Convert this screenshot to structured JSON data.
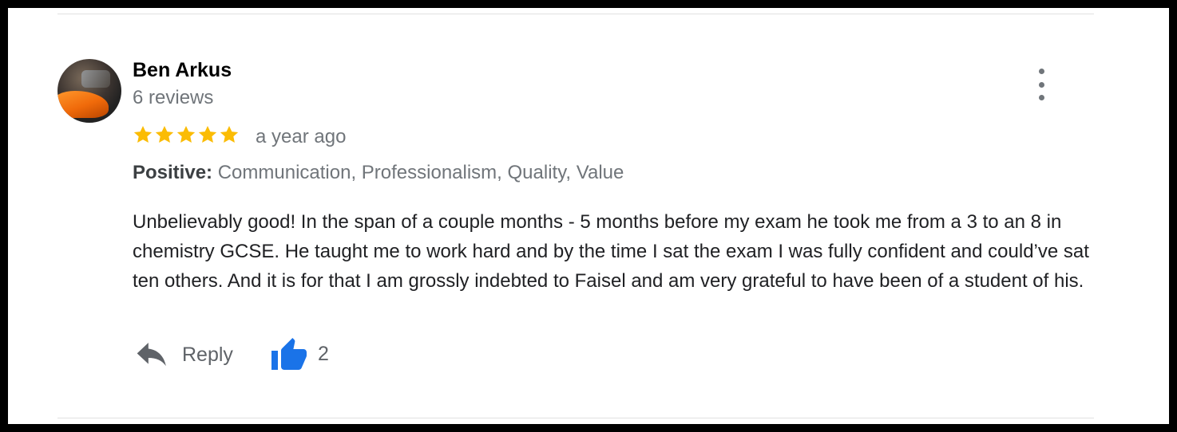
{
  "review": {
    "author": "Ben Arkus",
    "author_reviews": "6 reviews",
    "rating": 5,
    "rating_max": 5,
    "time": "a year ago",
    "positive_label": "Positive:",
    "positive_values": "Communication, Professionalism, Quality, Value",
    "text": "Unbelievably good! In the span of a couple months - 5 months before my exam he took me from a 3 to an 8 in chemistry GCSE. He taught me to work hard and by the time I sat the exam I was fully confident and could’ve sat ten others. And it is for that I am grossly indebted to Faisel and am very grateful to have been of a student of his."
  },
  "actions": {
    "reply_label": "Reply",
    "like_count": "2"
  },
  "icons": {
    "avatar": "user-avatar-photo",
    "more": "more-vert-icon",
    "star": "star-icon",
    "reply": "reply-arrow-icon",
    "like": "thumbs-up-icon"
  },
  "colors": {
    "star": "#fbbc04",
    "like": "#1a73e8",
    "muted": "#70757a",
    "text": "#202124"
  }
}
